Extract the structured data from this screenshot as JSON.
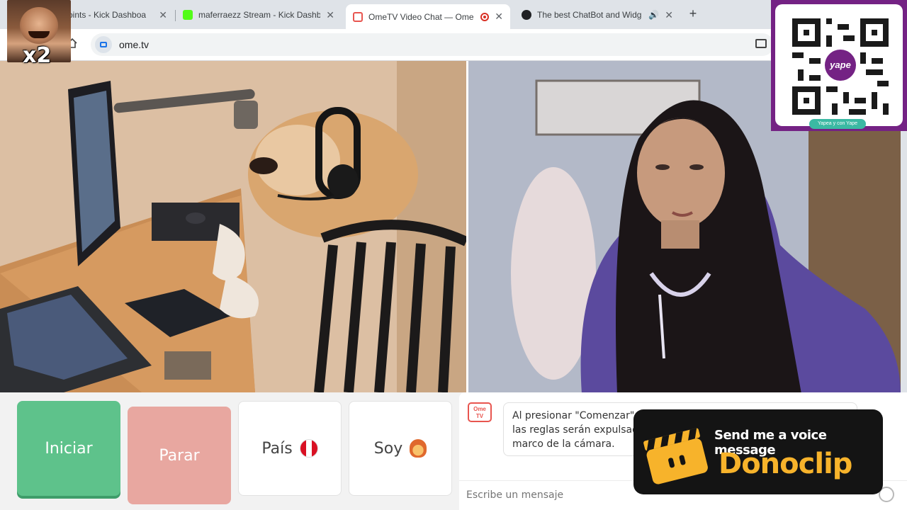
{
  "browser": {
    "tabs": [
      {
        "title": "oints - Kick Dashboa",
        "favicon_color": "#3c4043",
        "active": false
      },
      {
        "title": "maferraezz Stream - Kick Dashb",
        "favicon_color": "#53fc18",
        "active": false
      },
      {
        "title": "OmeTV Video Chat — Ome",
        "favicon_color": "#e8554f",
        "active": true,
        "recording": true
      },
      {
        "title": "The best ChatBot and Widg",
        "favicon_color": "#202124",
        "active": false,
        "audio": true
      }
    ],
    "close_glyph": "✕",
    "new_tab_glyph": "+",
    "url": "ome.tv"
  },
  "overlay": {
    "emote_multiplier": "x2",
    "qr_brand": "yape",
    "qr_caption": "Yapea y con Yape"
  },
  "controls": {
    "start_label": "Iniciar",
    "stop_label": "Parar",
    "country_label": "País",
    "country_flag": "peru-flag-icon",
    "me_label": "Soy",
    "me_emoji": "person-emoji-icon"
  },
  "chat": {
    "logo_text": "Ome TV",
    "system_message": "Al presionar \"Comenzar\", ar... las reglas serán expulsad... marco de la cámara.",
    "system_message_lines": [
      "Al presionar \"Comenzar\", ar",
      "las reglas serán expulsad",
      "marco de la cámara."
    ],
    "input_placeholder": "Escribe un mensaje"
  },
  "donoclip": {
    "tagline": "Send me a voice message",
    "brand": "Donoclip",
    "accent": "#f7b32b"
  }
}
